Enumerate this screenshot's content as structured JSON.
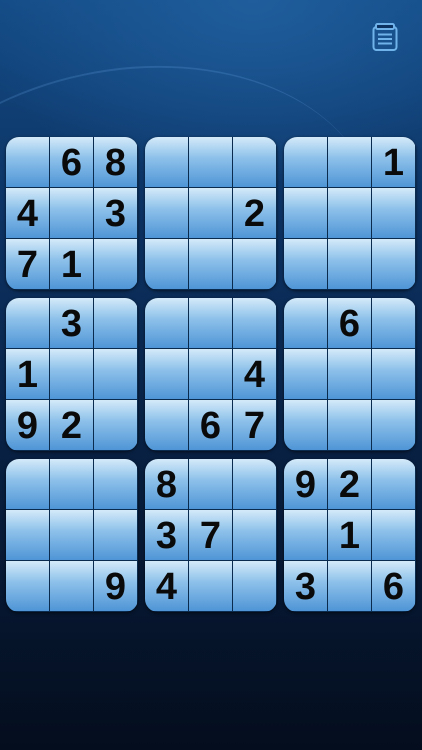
{
  "toolbar": {
    "menu_icon": "notepad-list-icon"
  },
  "colors": {
    "cell_top": "#d4eaf9",
    "cell_mid": "#8dc1ea",
    "cell_bottom": "#4f95d6",
    "grid_line": "#0a2a4e",
    "digit": "#0a0a0a",
    "icon": "#6fb3ea",
    "background_top": "#134a84",
    "background_bottom": "#040d1d"
  },
  "puzzle": {
    "rows": [
      [
        "",
        "6",
        "8",
        "",
        "",
        "",
        "",
        "",
        "1"
      ],
      [
        "4",
        "",
        "3",
        "",
        "",
        "2",
        "",
        "",
        ""
      ],
      [
        "7",
        "1",
        "",
        "",
        "",
        "",
        "",
        "",
        ""
      ],
      [
        "",
        "3",
        "",
        "",
        "",
        "",
        "",
        "6",
        ""
      ],
      [
        "1",
        "",
        "",
        "",
        "",
        "4",
        "",
        "",
        ""
      ],
      [
        "9",
        "2",
        "",
        "",
        "6",
        "7",
        "",
        "",
        ""
      ],
      [
        "",
        "",
        "",
        "8",
        "",
        "",
        "9",
        "2",
        ""
      ],
      [
        "",
        "",
        "",
        "3",
        "7",
        "",
        "",
        "1",
        ""
      ],
      [
        "",
        "",
        "9",
        "4",
        "",
        "",
        "3",
        "",
        "6"
      ]
    ]
  }
}
